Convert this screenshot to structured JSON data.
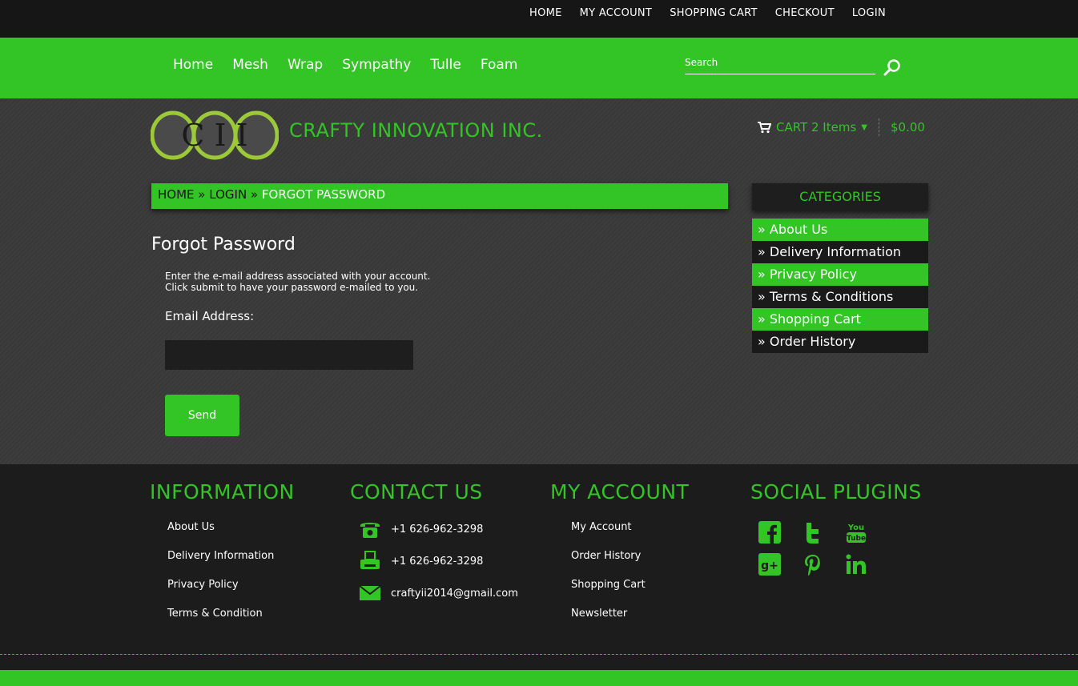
{
  "top_links": [
    "HOME",
    "MY ACCOUNT",
    "SHOPPING CART",
    "CHECKOUT",
    "LOGIN"
  ],
  "nav": [
    "Home",
    "Mesh",
    "Wrap",
    "Sympathy",
    "Tulle",
    "Foam"
  ],
  "search": {
    "placeholder": "Search"
  },
  "brand": {
    "logo_letters": "C I I",
    "name": "CRAFTY INNOVATION INC."
  },
  "cart": {
    "label": "CART 2 Items",
    "total": "$0.00"
  },
  "breadcrumb": {
    "home": "HOME",
    "sep1": "»",
    "login": "LOGIN",
    "sep2": "»",
    "current": "FORGOT PASSWORD"
  },
  "form": {
    "title": "Forgot Password",
    "intro_line1": "Enter the e-mail address associated with your account.",
    "intro_line2": "Click submit to have your password e-mailed to you.",
    "email_label": "Email Address:",
    "email_value": "",
    "submit_label": "Send"
  },
  "categories": {
    "title": "CATEGORIES",
    "items": [
      "» About Us",
      "» Delivery Information",
      "» Privacy Policy",
      "» Terms & Conditions",
      "» Shopping Cart",
      "» Order History"
    ]
  },
  "footer": {
    "information": {
      "title": "INFORMATION",
      "links": [
        "About Us",
        "Delivery Information",
        "Privacy Policy",
        "Terms & Condition"
      ]
    },
    "contact": {
      "title": "CONTACT US",
      "phone": "+1 626-962-3298",
      "fax": "+1 626-962-3298",
      "email": "craftyii2014@gmail.com"
    },
    "account": {
      "title": "MY ACCOUNT",
      "links": [
        "My Account",
        "Order History",
        "Shopping Cart",
        "Newsletter"
      ]
    },
    "social": {
      "title": "SOCIAL PLUGINS",
      "icons": [
        "facebook-icon",
        "twitter-icon",
        "youtube-icon",
        "google-plus-icon",
        "pinterest-icon",
        "linkedin-icon"
      ]
    }
  },
  "colors": {
    "accent": "#33c425",
    "dark": "#161616",
    "body": "#3c3c3c"
  }
}
